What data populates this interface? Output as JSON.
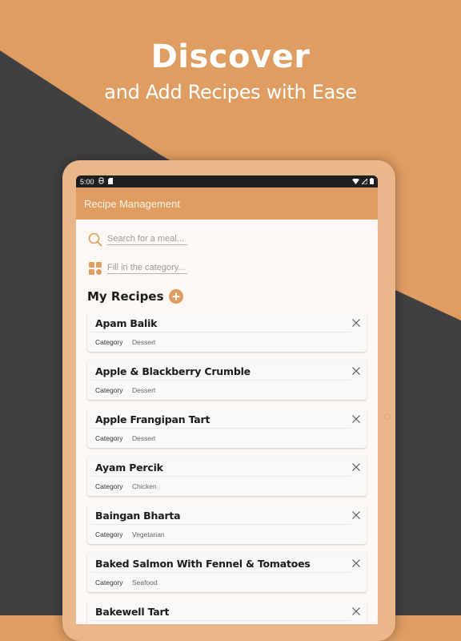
{
  "hero": {
    "title": "Discover",
    "subtitle": "and Add Recipes with Ease"
  },
  "status_bar": {
    "time": "5:00"
  },
  "app_bar": {
    "title": "Recipe Management"
  },
  "search": {
    "placeholder": "Search for a meal...",
    "value": ""
  },
  "category_filter": {
    "placeholder": "Fill in the category...",
    "value": ""
  },
  "section": {
    "title": "My Recipes"
  },
  "recipes": [
    {
      "name": "Apam Balik",
      "category_label": "Category",
      "category": "Dessert"
    },
    {
      "name": "Apple & Blackberry Crumble",
      "category_label": "Category",
      "category": "Dessert"
    },
    {
      "name": "Apple Frangipan Tart",
      "category_label": "Category",
      "category": "Dessert"
    },
    {
      "name": "Ayam Percik",
      "category_label": "Category",
      "category": "Chicken"
    },
    {
      "name": "Baingan Bharta",
      "category_label": "Category",
      "category": "Vegetarian"
    },
    {
      "name": "Baked Salmon With Fennel & Tomatoes",
      "category_label": "Category",
      "category": "Seafood"
    },
    {
      "name": "Bakewell Tart",
      "category_label": "Category",
      "category": ""
    }
  ],
  "colors": {
    "accent": "#e09d62",
    "dark": "#414041",
    "device_frame": "#eab78a",
    "screen_bg": "#fdf8f4"
  }
}
